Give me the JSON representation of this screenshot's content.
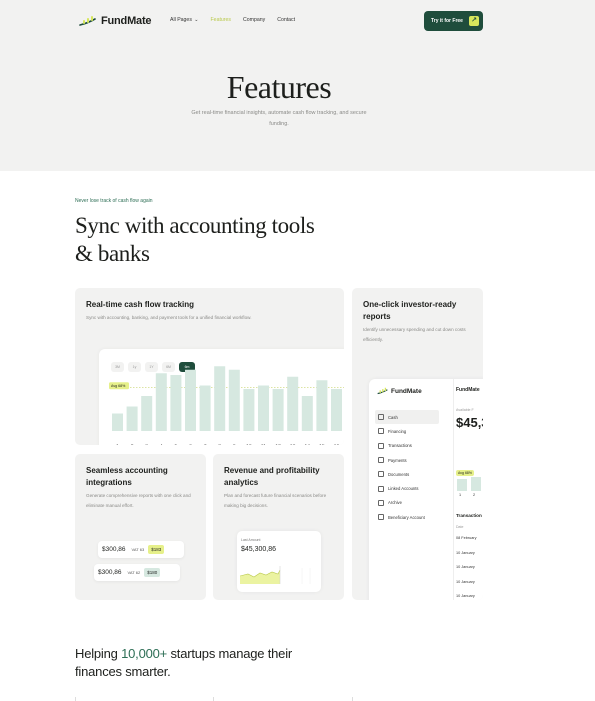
{
  "brand": {
    "name": "FundMate",
    "accent": "#1f4d3c",
    "highlight": "#d7e75c",
    "link_active": "#b9c94a"
  },
  "nav": {
    "items": [
      {
        "label": "All Pages",
        "dropdown": true,
        "active": false
      },
      {
        "label": "Features",
        "active": true
      },
      {
        "label": "Company",
        "active": false
      },
      {
        "label": "Contact",
        "active": false
      }
    ],
    "cta_label": "Try it for Free"
  },
  "hero": {
    "title": "Features",
    "subtitle": "Get real-time financial insights, automate cash flow tracking, and secure funding."
  },
  "section": {
    "eyebrow": "Never lose track of cash flow again",
    "title": "Sync with accounting tools & banks"
  },
  "cards": {
    "cashflow": {
      "title": "Real-time cash flow tracking",
      "desc": "Sync with accounting, banking, and payment tools for a unified financial workflow.",
      "chips": [
        "3M",
        "1y",
        "1Y",
        "6M",
        "6m"
      ],
      "avg_label": "Avg 68%",
      "x_labels": [
        "1",
        "2",
        "3",
        "4",
        "5",
        "6",
        "7",
        "8",
        "9",
        "10",
        "11",
        "12",
        "13",
        "14",
        "15",
        "16"
      ],
      "values": [
        20,
        28,
        40,
        66,
        64,
        70,
        52,
        74,
        70,
        48,
        52,
        48,
        62,
        40,
        58,
        48
      ],
      "avg_value": 50
    },
    "investor": {
      "title": "One-click investor-ready reports",
      "desc": "Identify unnecessary spending and cut down costs efficiently.",
      "app_name": "FundMate",
      "menu": [
        "Cash",
        "Financing",
        "Transactions",
        "Payments",
        "Documents",
        "Linked Accounts",
        "Archive",
        "Beneficiary Account"
      ],
      "menu_icons": [
        "cash-icon",
        "financing-icon",
        "transactions-icon",
        "payments-icon",
        "documents-icon",
        "link-icon",
        "archive-icon",
        "beneficiary-icon"
      ],
      "right_title": "FundMate",
      "available_label": "Available F",
      "amount": "$45,3",
      "badge": "Avg 68%",
      "x_labels": [
        "1",
        "2"
      ],
      "transactions_label": "Transaction",
      "date_label": "Date",
      "rows": [
        "08 February",
        "10 January",
        "10 January",
        "10 January",
        "10 January"
      ]
    },
    "accounting": {
      "title": "Seamless accounting integrations",
      "desc": "Generate comprehensive reports with one click and eliminate manual effort.",
      "rows": [
        {
          "amount": "$300,86",
          "vat": "VAT 63",
          "tag": "$183"
        },
        {
          "amount": "$300,86",
          "vat": "VAT 62",
          "tag": "$180"
        }
      ]
    },
    "revenue": {
      "title": "Revenue and profitability analytics",
      "desc": "Plan and forecast future financial scenarios before making big decisions.",
      "label": "Last Amount",
      "amount": "$45,300,86"
    }
  },
  "footer_text": {
    "before": "Helping ",
    "highlight": "10,000+",
    "after": " startups manage their finances smarter."
  }
}
